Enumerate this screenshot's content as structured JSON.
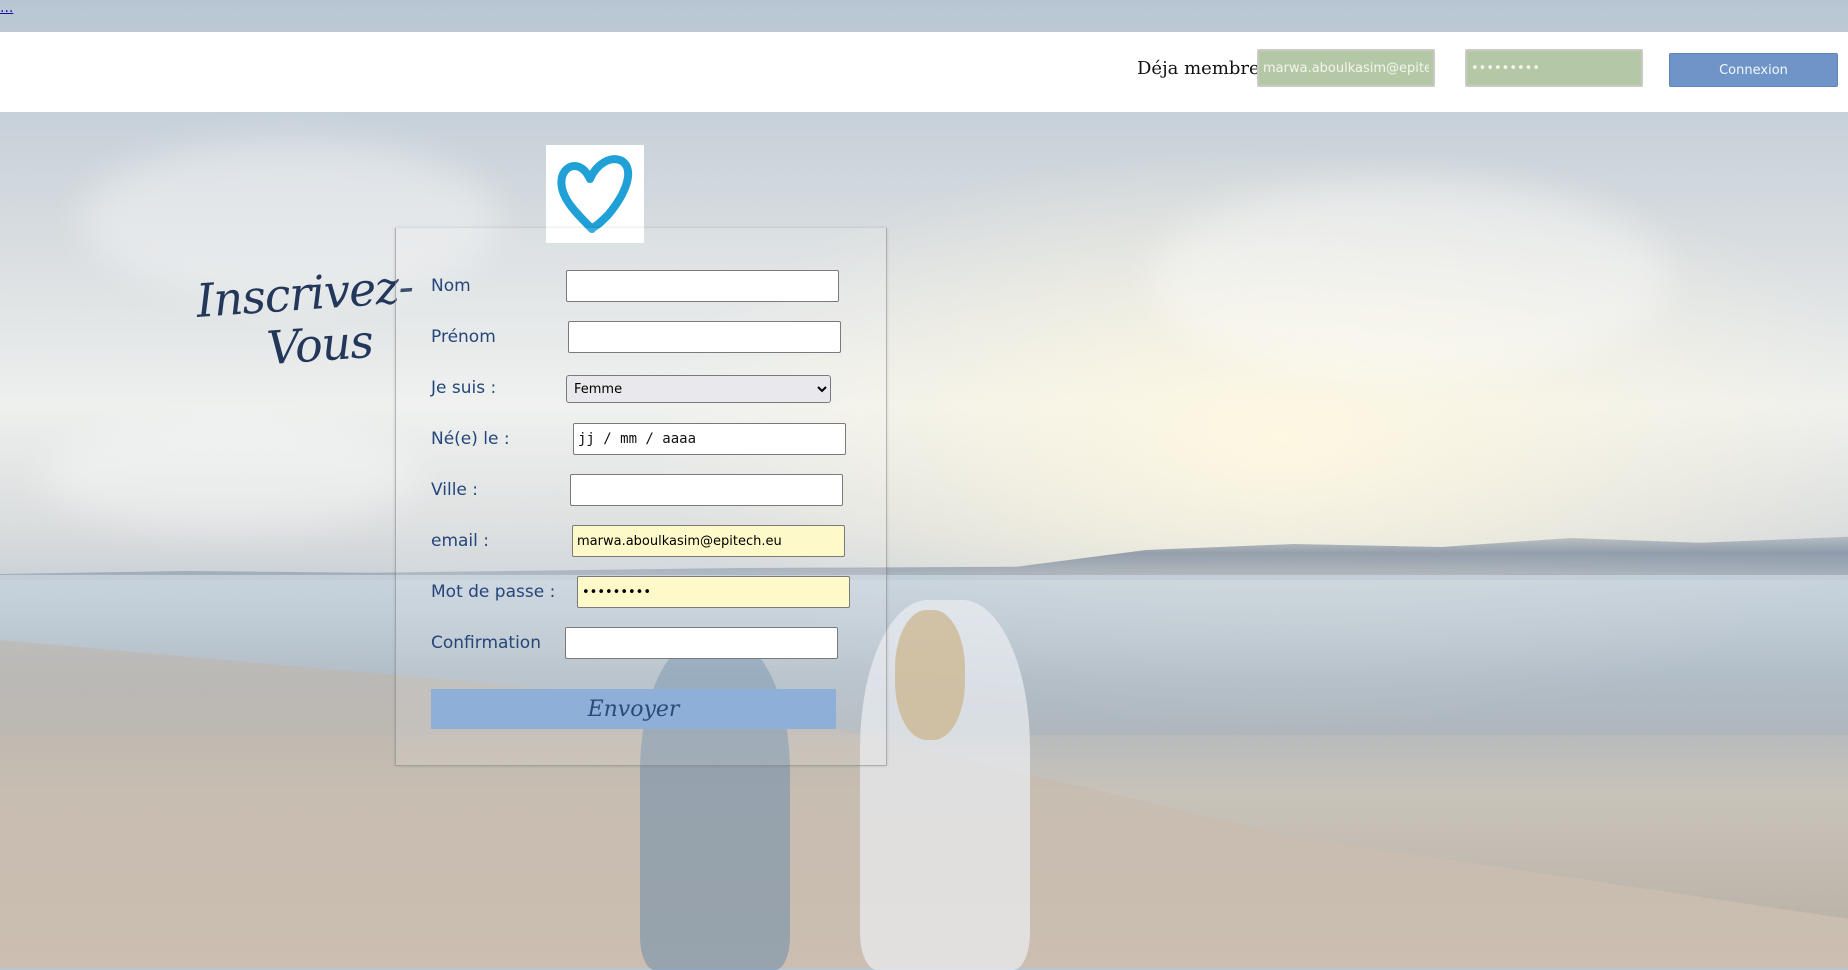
{
  "skip_link": "...",
  "header": {
    "member_label": "Déja membre",
    "login_email_value": "marwa.aboulkasim@epitech",
    "login_password_value": "•••••••••",
    "connexion_label": "Connexion"
  },
  "side_heading": {
    "line1": "Inscrivez-",
    "line2": "Vous"
  },
  "form": {
    "nom_label": "Nom",
    "prenom_label": "Prénom",
    "gender_label": "Je suis :",
    "gender_selected": "Femme",
    "birth_label": "Né(e) le :",
    "birth_placeholder": "jj / mm / aaaa",
    "ville_label": "Ville :",
    "email_label": "email :",
    "email_value": "marwa.aboulkasim@epitech.eu",
    "password_label": "Mot de passe :",
    "password_value": "•••••••••",
    "confirm_label": "Confirmation",
    "submit_label": "Envoyer"
  },
  "colors": {
    "accent": "#6f94c8",
    "submit_bg": "#8eb0d8",
    "heart": "#1fa0d6",
    "label_text": "#24467a",
    "autofill": "#fdf9c8"
  },
  "icons": {
    "logo": "heart-icon",
    "select_arrow": "chevron-down-icon"
  }
}
